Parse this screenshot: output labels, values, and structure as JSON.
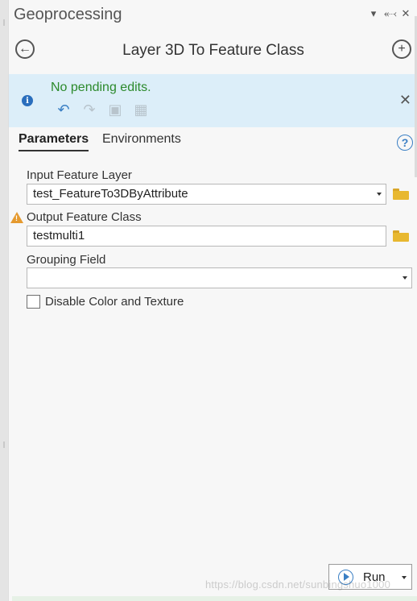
{
  "pane": {
    "title": "Geoprocessing",
    "icons": [
      "dropdown-icon",
      "pin-icon",
      "close-icon"
    ]
  },
  "tool": {
    "title": "Layer 3D To Feature Class"
  },
  "edits": {
    "message": "No pending edits."
  },
  "tabs": {
    "parameters": "Parameters",
    "environments": "Environments"
  },
  "params": {
    "input_label": "Input Feature Layer",
    "input_value": "test_FeatureTo3DByAttribute",
    "output_label": "Output Feature Class",
    "output_value": "testmulti1",
    "grouping_label": "Grouping Field",
    "grouping_value": "",
    "disable_label": "Disable Color and Texture",
    "disable_checked": false
  },
  "run": {
    "label": "Run"
  },
  "watermark": "https://blog.csdn.net/sunbingshuo1000",
  "colors": {
    "edits_bg": "#dceef9",
    "edits_text": "#2c8a2c",
    "accent": "#3a7fc4",
    "warning": "#e59a2f",
    "folder": "#e8b830"
  }
}
